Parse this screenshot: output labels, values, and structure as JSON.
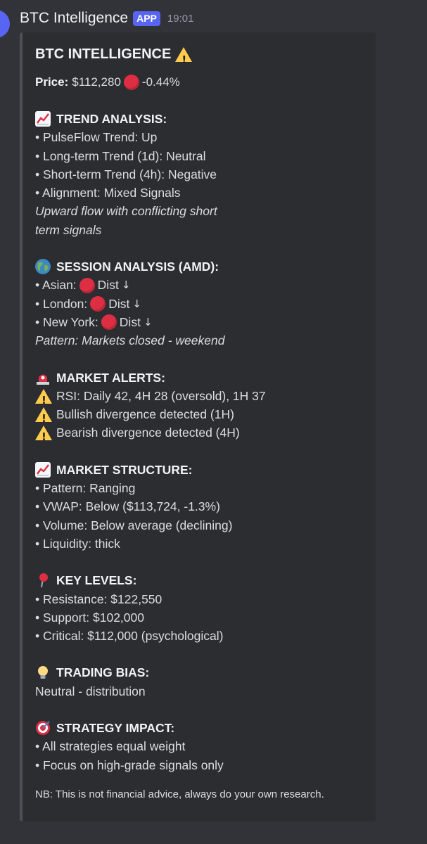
{
  "message": {
    "app_name": "BTC Intelligence",
    "badge": "APP",
    "timestamp": "19:01"
  },
  "embed": {
    "title": "BTC INTELLIGENCE",
    "price_label": "Price:",
    "price_value": "$112,280",
    "price_change": "-0.44%",
    "trend": {
      "heading": "TREND ANALYSIS:",
      "items": [
        "• PulseFlow Trend: Up",
        "• Long-term Trend (1d): Neutral",
        "• Short-term Trend (4h): Negative",
        "• Alignment: Mixed Signals"
      ],
      "note_line1": "Upward flow with conflicting short",
      "note_line2": "term signals"
    },
    "session": {
      "heading": "SESSION ANALYSIS (AMD):",
      "items": [
        {
          "label": "• Asian:",
          "value": "Dist"
        },
        {
          "label": "• London:",
          "value": "Dist"
        },
        {
          "label": "• New York:",
          "value": "Dist"
        }
      ],
      "arrow": "↓",
      "note": "Pattern: Markets closed - weekend"
    },
    "alerts": {
      "heading": "MARKET ALERTS:",
      "items": [
        "RSI: Daily 42, 4H 28 (oversold), 1H 37",
        "Bullish divergence detected (1H)",
        "Bearish divergence detected (4H)"
      ]
    },
    "structure": {
      "heading": "MARKET STRUCTURE:",
      "items": [
        "• Pattern: Ranging",
        "• VWAP: Below ($113,724, -1.3%)",
        "• Volume: Below average (declining)",
        "• Liquidity: thick"
      ]
    },
    "levels": {
      "heading": "KEY LEVELS:",
      "items": [
        "• Resistance: $122,550",
        "• Support: $102,000",
        "• Critical: $112,000 (psychological)"
      ]
    },
    "bias": {
      "heading": "TRADING BIAS:",
      "value": "Neutral - distribution"
    },
    "strategy": {
      "heading": "STRATEGY IMPACT:",
      "items": [
        "• All strategies equal weight",
        "• Focus on high-grade signals only"
      ]
    },
    "footer": "NB: This is not financial advice, always do your own research."
  },
  "colors": {
    "background": "#323339",
    "embed_bg": "#2b2d31",
    "badge": "#5865f2",
    "red_dot": "#dd2e44",
    "warning": "#ffcc4d"
  },
  "icons": [
    "warning-icon",
    "red-circle-icon",
    "chart-increasing-icon",
    "globe-icon",
    "siren-icon",
    "pin-icon",
    "bulb-icon",
    "target-icon"
  ]
}
